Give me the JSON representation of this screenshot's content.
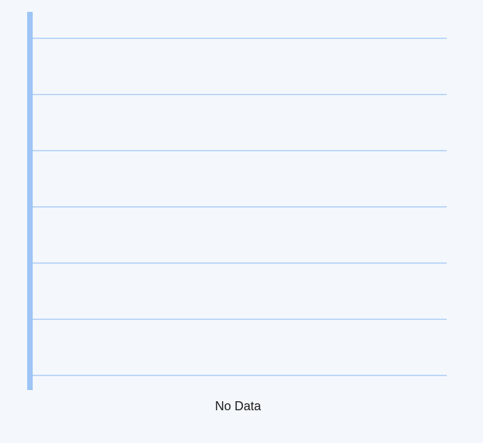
{
  "chart_data": {
    "type": "line",
    "title": "",
    "xlabel": "",
    "ylabel": "",
    "categories": [],
    "series": [],
    "gridlines": 7,
    "grid": true,
    "empty_message": "No Data"
  },
  "colors": {
    "background": "#f4f8fd",
    "axis": "#9ec5f5",
    "grid": "#a8cbf3",
    "text": "#1a1a1a"
  }
}
